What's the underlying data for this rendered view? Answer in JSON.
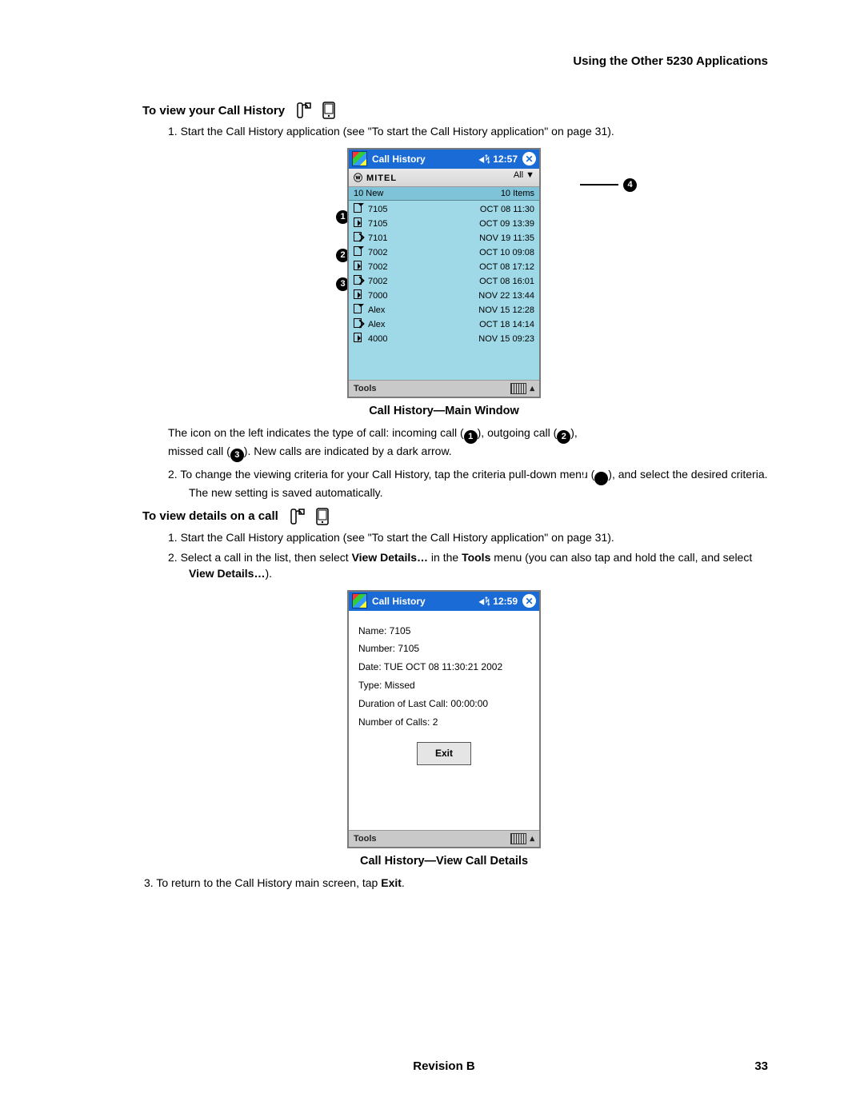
{
  "header": "Using the Other 5230 Applications",
  "section1": {
    "title": "To view your Call History",
    "step1": "Start the Call History application (see \"To start the Call History application\" on page 31).",
    "caption": "Call History—Main Window",
    "para_a": "The icon on the left indicates the type of call: incoming call (",
    "para_b": "), outgoing call (",
    "para_c": "),",
    "para_d": "missed call (",
    "para_e": "). New calls are indicated by a dark arrow.",
    "step2": "To change the viewing criteria for your Call History, tap the criteria pull-down menu (",
    "step2b": "), and select the desired criteria. The new setting is saved automatically."
  },
  "pda1": {
    "title": "Call History",
    "time": "◀ᛪ 12:57",
    "brand": "ⓦ MITEL",
    "filter": "All ▼",
    "left_count": "10 New",
    "right_count": "10 Items",
    "rows": [
      {
        "icon": "in",
        "num": "7105",
        "dt": "OCT 08 11:30"
      },
      {
        "icon": "out",
        "num": "7105",
        "dt": "OCT 09 13:39"
      },
      {
        "icon": "miss",
        "num": "7101",
        "dt": "NOV 19 11:35"
      },
      {
        "icon": "in",
        "num": "7002",
        "dt": "OCT 10 09:08"
      },
      {
        "icon": "out",
        "num": "7002",
        "dt": "OCT 08 17:12"
      },
      {
        "icon": "miss",
        "num": "7002",
        "dt": "OCT 08 16:01"
      },
      {
        "icon": "out",
        "num": "7000",
        "dt": "NOV 22 13:44"
      },
      {
        "icon": "in",
        "num": "Alex",
        "dt": "NOV 15 12:28"
      },
      {
        "icon": "miss",
        "num": "Alex",
        "dt": "OCT 18 14:14"
      },
      {
        "icon": "out",
        "num": "4000",
        "dt": "NOV 15 09:23"
      }
    ],
    "tools": "Tools"
  },
  "section2": {
    "title": "To view details on a call",
    "step1": "Start the Call History application (see \"To start the Call History application\" on page 31).",
    "step2_a": "Select a call in the list, then select ",
    "step2_b": "View Details…",
    "step2_c": " in the ",
    "step2_d": "Tools",
    "step2_e": " menu (you can also tap and hold the call, and select ",
    "step2_f": "View Details…",
    "step2_g": ").",
    "caption": "Call History—View Call Details",
    "step3_a": "To return to the Call History main screen, tap ",
    "step3_b": "Exit",
    "step3_c": "."
  },
  "pda2": {
    "title": "Call History",
    "time": "◀ᛪ 12:59",
    "lines": {
      "name": "Name: 7105",
      "number": "Number: 7105",
      "date": "Date: TUE OCT 08 11:30:21 2002",
      "type": "Type: Missed",
      "duration": "Duration of Last Call: 00:00:00",
      "calls": "Number of Calls: 2"
    },
    "exit": "Exit",
    "tools": "Tools"
  },
  "callouts": {
    "c1": "1",
    "c2": "2",
    "c3": "3",
    "c4": "4"
  },
  "footer": {
    "rev": "Revision B",
    "page": "33"
  }
}
